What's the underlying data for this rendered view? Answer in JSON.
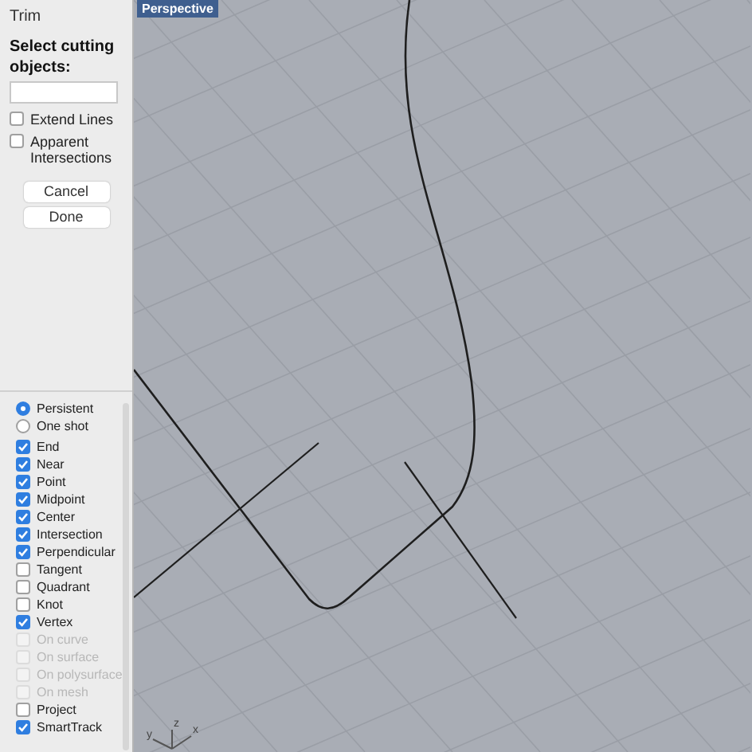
{
  "panel": {
    "title": "Trim",
    "prompt": "Select cutting objects:",
    "options": [
      {
        "label": "Extend Lines",
        "checked": false
      },
      {
        "label": "Apparent Intersections",
        "checked": false
      }
    ],
    "buttons": [
      "Cancel",
      "Done"
    ]
  },
  "osnap": {
    "modes": [
      {
        "label": "Persistent",
        "selected": true
      },
      {
        "label": "One shot",
        "selected": false
      }
    ],
    "items": [
      {
        "label": "End",
        "checked": true,
        "disabled": false
      },
      {
        "label": "Near",
        "checked": true,
        "disabled": false
      },
      {
        "label": "Point",
        "checked": true,
        "disabled": false
      },
      {
        "label": "Midpoint",
        "checked": true,
        "disabled": false
      },
      {
        "label": "Center",
        "checked": true,
        "disabled": false
      },
      {
        "label": "Intersection",
        "checked": true,
        "disabled": false
      },
      {
        "label": "Perpendicular",
        "checked": true,
        "disabled": false
      },
      {
        "label": "Tangent",
        "checked": false,
        "disabled": false
      },
      {
        "label": "Quadrant",
        "checked": false,
        "disabled": false
      },
      {
        "label": "Knot",
        "checked": false,
        "disabled": false
      },
      {
        "label": "Vertex",
        "checked": true,
        "disabled": false
      },
      {
        "label": "On curve",
        "checked": false,
        "disabled": true
      },
      {
        "label": "On surface",
        "checked": false,
        "disabled": true
      },
      {
        "label": "On polysurface",
        "checked": false,
        "disabled": true
      },
      {
        "label": "On mesh",
        "checked": false,
        "disabled": true
      },
      {
        "label": "Project",
        "checked": false,
        "disabled": false
      },
      {
        "label": "SmartTrack",
        "checked": true,
        "disabled": false
      }
    ]
  },
  "viewport": {
    "title": "Perspective",
    "axes": [
      "x",
      "y",
      "z"
    ]
  }
}
